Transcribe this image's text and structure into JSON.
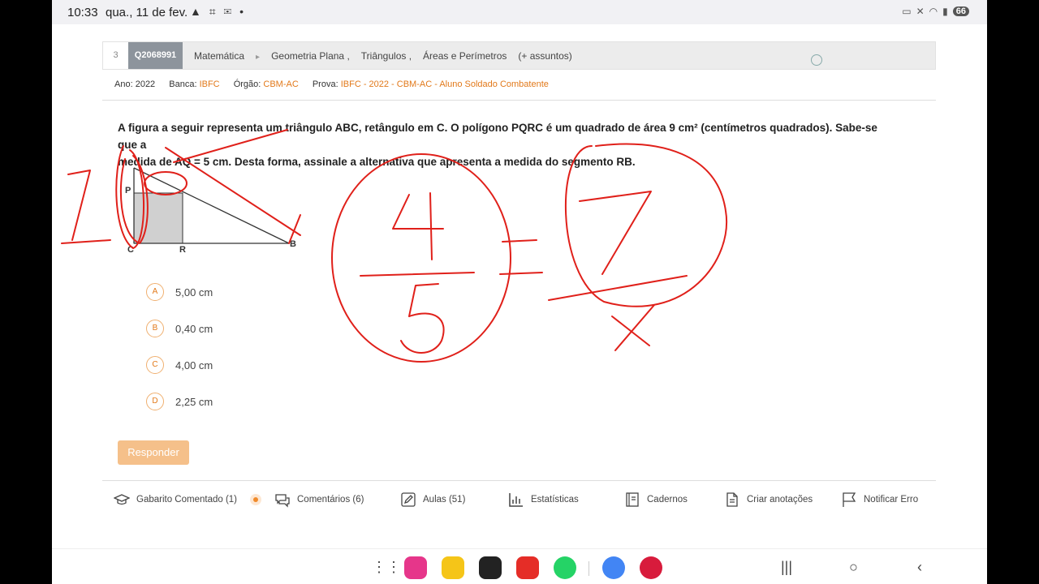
{
  "status": {
    "time": "10:33",
    "date": "qua., 11 de fev.",
    "battery": "66"
  },
  "question": {
    "number": "3",
    "id": "Q2068991",
    "subjects": [
      "Matemática",
      "Geometria Plana ,",
      "Triângulos ,",
      "Áreas e Perímetros",
      "(+ assuntos)"
    ],
    "meta": [
      {
        "label": "Ano:",
        "value": "2022"
      },
      {
        "label": "Banca:",
        "value": "IBFC"
      },
      {
        "label": "Órgão:",
        "value": "CBM-AC"
      },
      {
        "label": "Prova:",
        "value": "IBFC - 2022 - CBM-AC - Aluno Soldado Combatente"
      }
    ],
    "text_line1": "A figura a seguir representa um triângulo ABC, retângulo em C. O polígono PQRC é um quadrado de área 9 cm² (centímetros quadrados). Sabe-se que a",
    "text_line2": "medida de AQ = 5 cm. Desta forma, assinale a alternativa que apresenta a medida do segmento RB.",
    "figure_labels": {
      "p": "P",
      "c": "C",
      "r": "R",
      "b": "B"
    },
    "options": [
      {
        "letter": "A",
        "text": "5,00 cm"
      },
      {
        "letter": "B",
        "text": "0,40 cm"
      },
      {
        "letter": "C",
        "text": "4,00 cm"
      },
      {
        "letter": "D",
        "text": "2,25 cm"
      }
    ],
    "submit_label": "Responder"
  },
  "footer": [
    {
      "label": "Gabarito Comentado (1)",
      "icon": "graduation-cap-icon"
    },
    {
      "label": "Comentários (6)",
      "icon": "chat-icon"
    },
    {
      "label": "Aulas (51)",
      "icon": "pencil-icon"
    },
    {
      "label": "Estatísticas",
      "icon": "bar-chart-icon"
    },
    {
      "label": "Cadernos",
      "icon": "notebook-icon"
    },
    {
      "label": "Criar anotações",
      "icon": "document-icon"
    },
    {
      "label": "Notificar Erro",
      "icon": "flag-icon"
    }
  ],
  "colors": {
    "accent": "#e2791a",
    "ink": "#e0201a",
    "id_badge": "#8d949c"
  }
}
